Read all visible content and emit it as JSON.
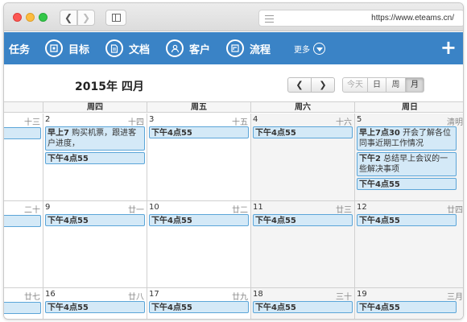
{
  "browser": {
    "url": "https://www.eteams.cn/",
    "back_glyph": "❮",
    "forward_glyph": "❯"
  },
  "nav": {
    "items": [
      {
        "label": "任务",
        "icon": "task-icon"
      },
      {
        "label": "目标",
        "icon": "target-icon"
      },
      {
        "label": "文档",
        "icon": "document-icon"
      },
      {
        "label": "客户",
        "icon": "customer-icon"
      },
      {
        "label": "流程",
        "icon": "workflow-icon"
      }
    ],
    "more_label": "更多",
    "add_label": "+"
  },
  "calendar": {
    "title": "2015年 四月",
    "prev_glyph": "❮",
    "next_glyph": "❯",
    "views": {
      "today": "今天",
      "day": "日",
      "week": "周",
      "month": "月"
    },
    "active_view": "month",
    "weekdays": [
      "周四",
      "周五",
      "周六",
      "周日"
    ],
    "rows": [
      {
        "partial": {
          "lunar": "十三",
          "events": [
            {
              "text": ""
            }
          ]
        },
        "days": [
          {
            "day": "2",
            "lunar": "十四",
            "events": [
              {
                "title": "早上7",
                "text": "购买机票，跟进客户进度，"
              },
              {
                "title": "下午4点55",
                "text": ""
              }
            ]
          },
          {
            "day": "3",
            "lunar": "十五",
            "events": [
              {
                "title": "下午4点55",
                "text": ""
              }
            ]
          },
          {
            "day": "4",
            "lunar": "十六",
            "events": [
              {
                "title": "下午4点55",
                "text": ""
              }
            ]
          },
          {
            "day": "5",
            "lunar": "清明",
            "events": [
              {
                "title": "早上7点30",
                "text": "开会了解各位同事近期工作情况"
              },
              {
                "title": "下午2",
                "text": "总结早上会议的一些解决事项"
              },
              {
                "title": "下午4点55",
                "text": ""
              }
            ]
          }
        ]
      },
      {
        "partial": {
          "lunar": "二十",
          "events": [
            {
              "text": ""
            }
          ]
        },
        "days": [
          {
            "day": "9",
            "lunar": "廿一",
            "events": [
              {
                "title": "下午4点55",
                "text": ""
              }
            ]
          },
          {
            "day": "10",
            "lunar": "廿二",
            "events": [
              {
                "title": "下午4点55",
                "text": ""
              }
            ]
          },
          {
            "day": "11",
            "lunar": "廿三",
            "events": [
              {
                "title": "下午4点55",
                "text": ""
              }
            ]
          },
          {
            "day": "12",
            "lunar": "廿四",
            "events": [
              {
                "title": "下午4点55",
                "text": ""
              }
            ]
          }
        ]
      },
      {
        "partial": {
          "lunar": "廿七",
          "events": [
            {
              "text": ""
            }
          ]
        },
        "days": [
          {
            "day": "16",
            "lunar": "廿八",
            "events": [
              {
                "title": "下午4点55",
                "text": ""
              }
            ]
          },
          {
            "day": "17",
            "lunar": "廿九",
            "events": [
              {
                "title": "下午4点55",
                "text": ""
              }
            ]
          },
          {
            "day": "18",
            "lunar": "三十",
            "events": [
              {
                "title": "下午4点55",
                "text": ""
              }
            ]
          },
          {
            "day": "19",
            "lunar": "三月",
            "events": [
              {
                "title": "下午4点55",
                "text": ""
              }
            ]
          }
        ]
      }
    ]
  }
}
